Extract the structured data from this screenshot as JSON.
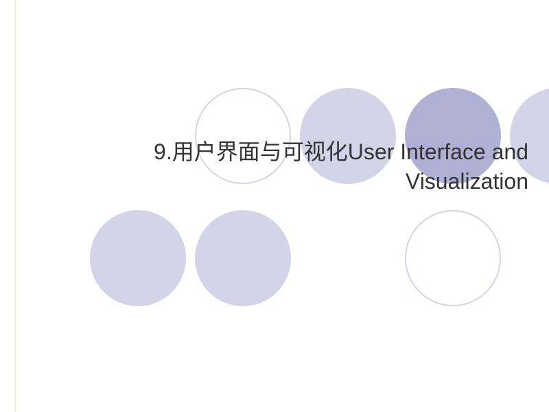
{
  "slide": {
    "title_line1": "9.用户界面与可视化User Interface and",
    "title_line2": "Visualization"
  },
  "decor": {
    "circle_light": "#d4d4e8",
    "circle_dark": "#b0b0d4",
    "hairline": "#e8e8b8"
  }
}
